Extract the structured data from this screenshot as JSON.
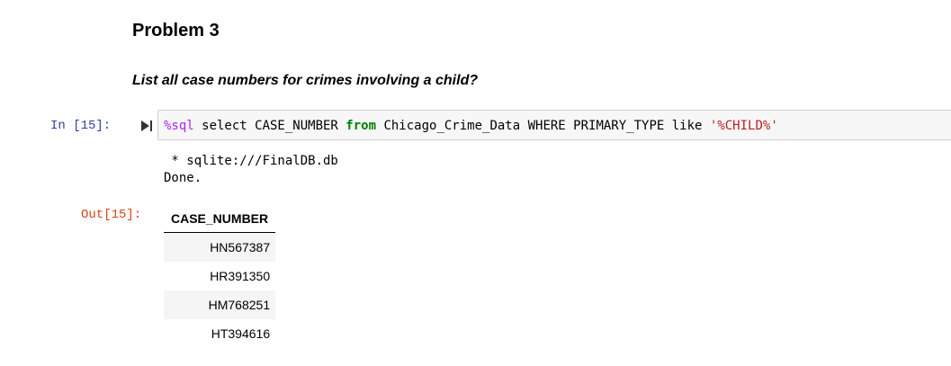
{
  "markdown": {
    "heading": "Problem 3",
    "question": "List all case numbers for crimes involving a child?"
  },
  "input_cell": {
    "prompt": "In [15]:",
    "run_icon": "run-cell-icon",
    "code": {
      "magic": "%sql",
      "part1": " select CASE_NUMBER ",
      "keyword": "from",
      "part2": " Chicago_Crime_Data WHERE PRIMARY_TYPE like ",
      "string": "'%CHILD%'"
    }
  },
  "stdout": {
    "connection": " * sqlite:///FinalDB.db",
    "status": "Done."
  },
  "output_cell": {
    "prompt": "Out[15]:",
    "table": {
      "header": "CASE_NUMBER",
      "rows": [
        "HN567387",
        "HR391350",
        "HM768251",
        "HT394616"
      ]
    }
  }
}
